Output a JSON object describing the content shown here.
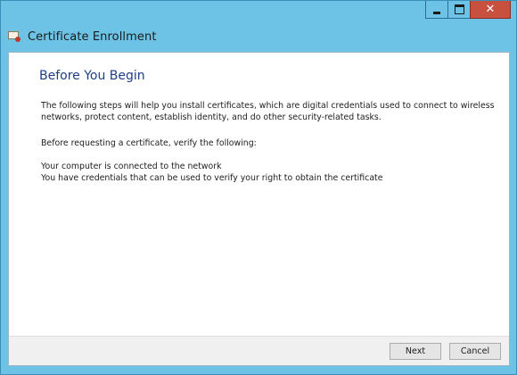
{
  "window": {
    "title": "Certificate Enrollment",
    "controls": {
      "minimize_icon": "minimize-icon",
      "maximize_icon": "maximize-icon",
      "close_icon": "close-icon",
      "close_glyph": "✕"
    },
    "colors": {
      "frame": "#6cc3e6",
      "heading": "#1e3f87",
      "close_button": "#c7503f"
    }
  },
  "page": {
    "heading": "Before You Begin",
    "intro": "The following steps will help you install certificates, which are digital credentials used to connect to wireless networks, protect content, establish identity, and do other security-related tasks.",
    "verify_prompt": "Before requesting a certificate, verify the following:",
    "requirements": [
      "Your computer is connected to the network",
      "You have credentials that can be used to verify your right to obtain the certificate"
    ]
  },
  "footer": {
    "next_label": "Next",
    "cancel_label": "Cancel"
  }
}
